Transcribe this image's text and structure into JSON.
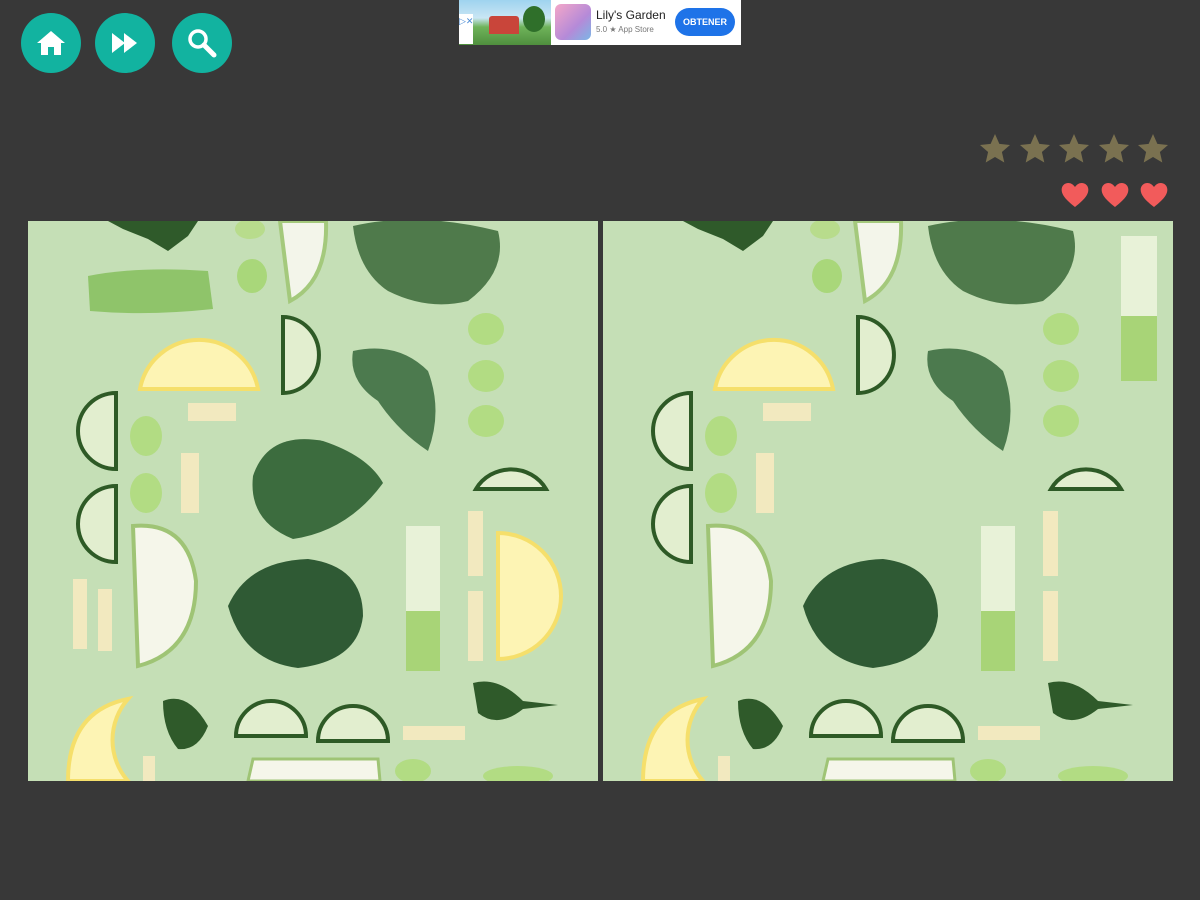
{
  "toolbar": {
    "buttons": [
      {
        "name": "home-button",
        "icon": "home-icon"
      },
      {
        "name": "skip-button",
        "icon": "fast-forward-icon"
      },
      {
        "name": "hint-button",
        "icon": "magnifier-icon"
      }
    ],
    "button_color": "#12b3a0"
  },
  "ad": {
    "title": "Lily's Garden",
    "subtitle": "5.0 ★ App Store",
    "cta": "OBTENER",
    "badge": "▷✕"
  },
  "status": {
    "stars_total": 5,
    "stars_earned": 0,
    "star_color": "#7a7150",
    "hearts_total": 3,
    "hearts_remaining": 3,
    "heart_color": "#f25b5b"
  },
  "puzzle": {
    "background_color": "#c5dfb6",
    "images": [
      {
        "name": "left-image"
      },
      {
        "name": "right-image"
      }
    ]
  }
}
